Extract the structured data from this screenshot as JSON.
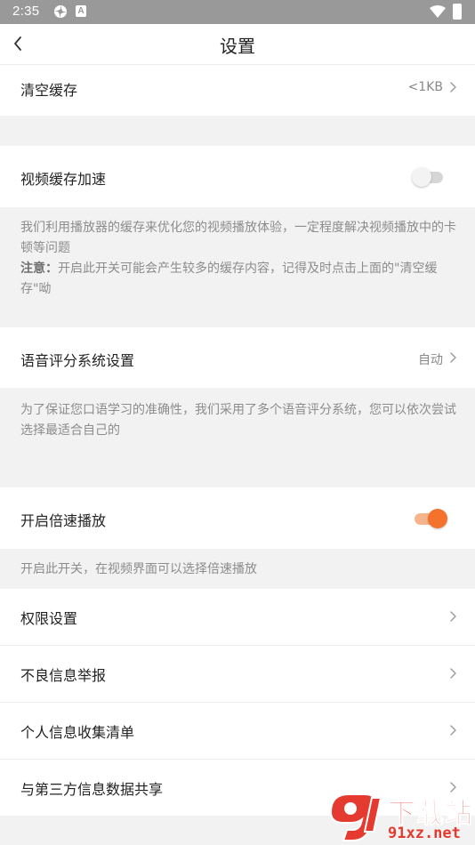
{
  "status_bar": {
    "time": "2:35",
    "notif_icons": [
      "gear-icon",
      "a-icon"
    ],
    "system_icons": [
      "wifi-icon",
      "battery-icon"
    ]
  },
  "header": {
    "title": "设置",
    "back_icon": "chevron-left-icon"
  },
  "clear_cache": {
    "label": "清空缓存",
    "value": "<1KB"
  },
  "video_cache_accel": {
    "label": "视频缓存加速",
    "enabled": false,
    "description": "我们利用播放器的缓存来优化您的视频播放体验，一定程度解决视频播放中的卡顿等问题",
    "note_label": "注意：",
    "note_text": "开启此开关可能会产生较多的缓存内容，记得及时点击上面的\"清空缓存\"呦"
  },
  "speech_eval": {
    "label": "语音评分系统设置",
    "value": "自动",
    "description": "为了保证您口语学习的准确性，我们采用了多个语音评分系统，您可以依次尝试选择最适合自己的"
  },
  "speed_play": {
    "label": "开启倍速播放",
    "enabled": true,
    "description": "开启此开关，在视频界面可以选择倍速播放"
  },
  "menu": [
    {
      "label": "权限设置"
    },
    {
      "label": "不良信息举报"
    },
    {
      "label": "个人信息收集清单"
    },
    {
      "label": "与第三方信息数据共享"
    }
  ],
  "watermark": {
    "title": "下载站",
    "site": "91xz.net"
  },
  "colors": {
    "accent": "#f5722d",
    "accent_light": "#f6b48c",
    "background": "#f2f2f2",
    "status_bar": "#999999",
    "watermark": "#e43a2f"
  }
}
